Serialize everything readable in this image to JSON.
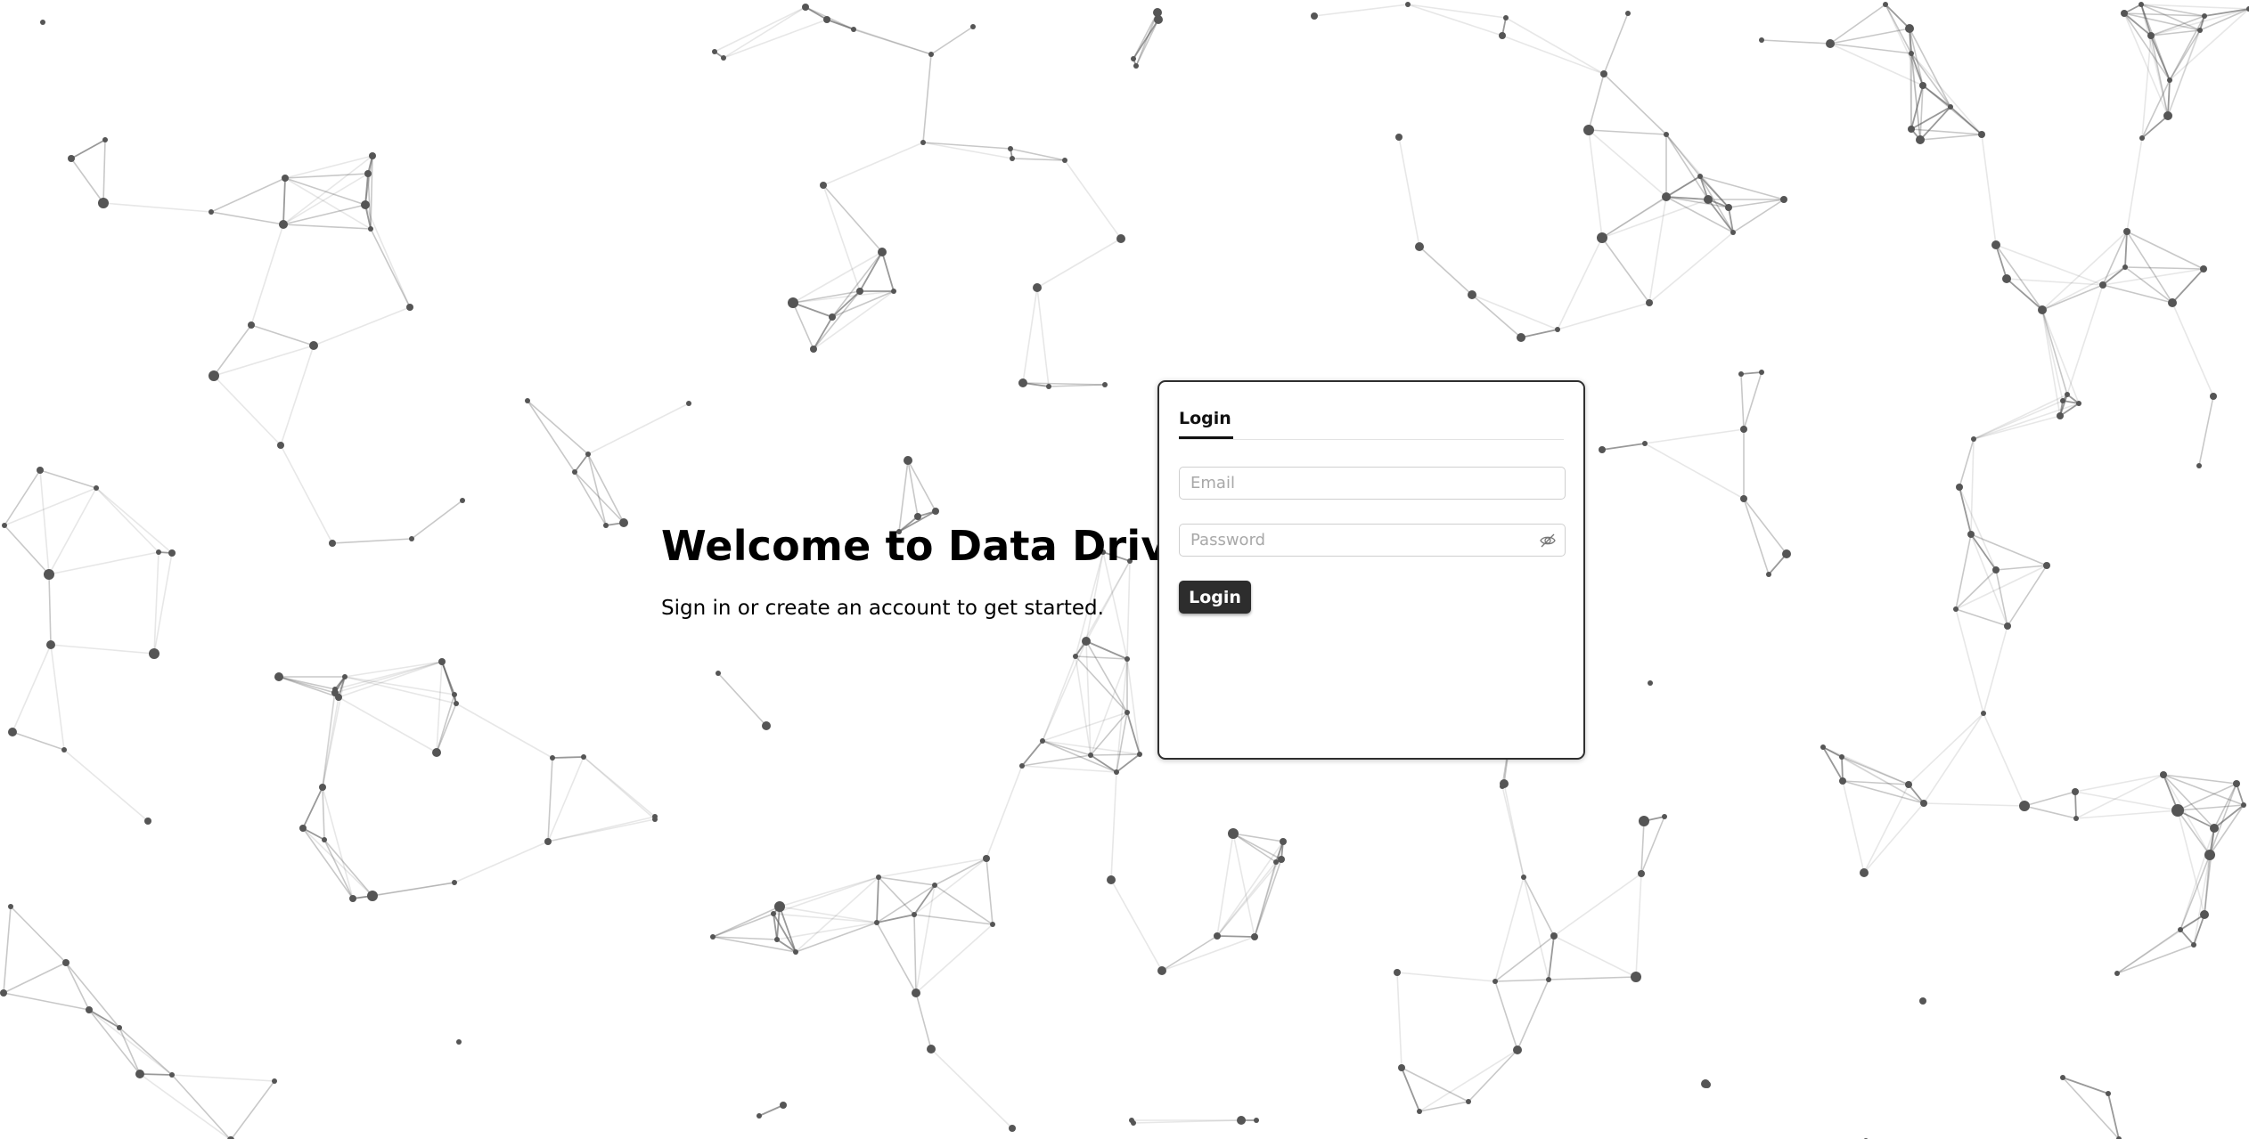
{
  "welcome": {
    "title": "Welcome to Data Drive!",
    "subtitle": "Sign in or create an account to get started."
  },
  "login_card": {
    "tab_label": "Login",
    "email_placeholder": "Email",
    "email_value": "",
    "password_placeholder": "Password",
    "password_value": "",
    "password_toggle_icon": "eye-off-icon",
    "submit_label": "Login"
  },
  "background": {
    "type": "particle-network",
    "node_color": "#555555",
    "line_color": "#555555",
    "page_color": "#ffffff"
  }
}
